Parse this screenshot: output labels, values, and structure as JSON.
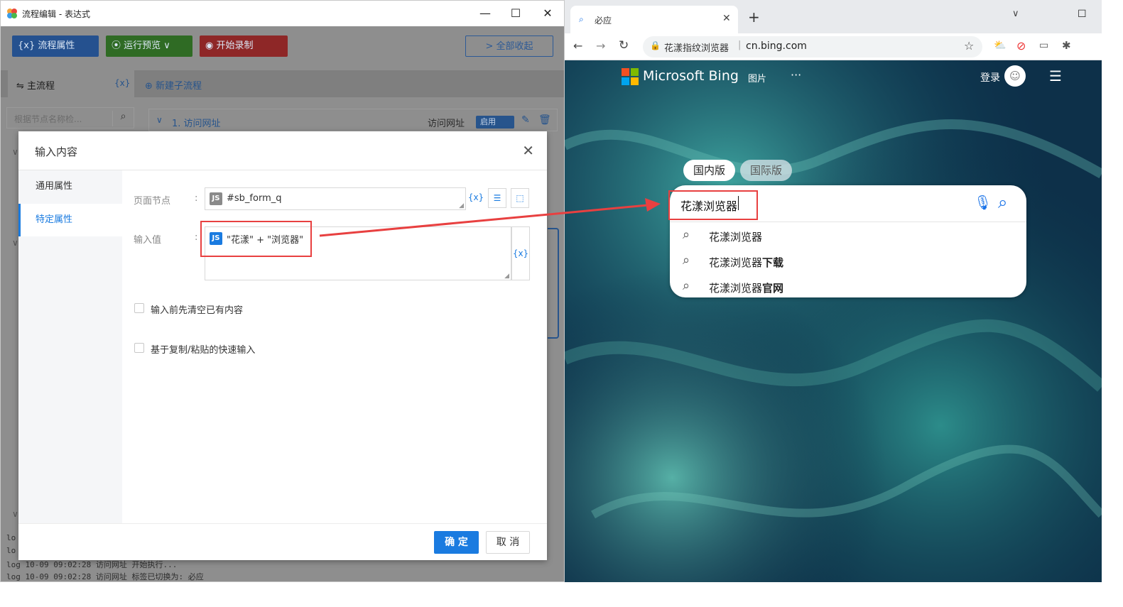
{
  "app": {
    "title": "流程编辑 - 表达式",
    "toolbar": {
      "flow_props": "{x} 流程属性",
      "run_preview": "运行预览",
      "start_record": "开始录制",
      "collapse_all": "> 全部收起"
    },
    "tabs": {
      "main_flow": "主流程",
      "var_icon": "{x}",
      "new_subflow": "新建子流程"
    },
    "search": {
      "placeholder": "根据节点名称检..."
    },
    "node": {
      "title": "1. 访问网址",
      "type": "访问网址",
      "toggle": "启用"
    },
    "log": [
      "lo",
      "lo",
      "log 10-09 09:02:28 访问网址 开始执行...",
      "log 10-09 09:02:28 访问网址 标签已切换为: 必应"
    ]
  },
  "dialog": {
    "title": "输入内容",
    "tabs": [
      "通用属性",
      "特定属性"
    ],
    "active_tab": "特定属性",
    "fields": {
      "page_node_label": "页面节点",
      "page_node_value": "#sb_form_q",
      "input_value_label": "输入值",
      "input_value": "\"花漾\" + \"浏览器\"",
      "js_badge": "JS",
      "var_btn": "{x}"
    },
    "options": [
      {
        "label": "输入前先清空已有内容",
        "checked": false
      },
      {
        "label": "基于复制/粘贴的快速输入",
        "checked": false
      }
    ],
    "confirm": "确 定",
    "cancel": "取 消"
  },
  "browser": {
    "tab_title": "必应",
    "site_name": "花漾指纹浏览器",
    "url": "cn.bing.com",
    "bing": {
      "logo": "Microsoft Bing",
      "images": "图片",
      "more": "···",
      "login": "登录",
      "domestic": "国内版",
      "international": "国际版",
      "query": "花漾浏览器",
      "suggestions": [
        {
          "prefix": "花漾浏览器",
          "bold": ""
        },
        {
          "prefix": "花漾浏览器",
          "bold": "下载"
        },
        {
          "prefix": "花漾浏览器",
          "bold": "官网"
        }
      ]
    }
  },
  "colors": {
    "primary": "#1a7be0",
    "flow_btn": "#2a64b3",
    "run_btn": "#3a8a2c",
    "record_btn": "#b02b2b",
    "highlight": "#e84040"
  }
}
